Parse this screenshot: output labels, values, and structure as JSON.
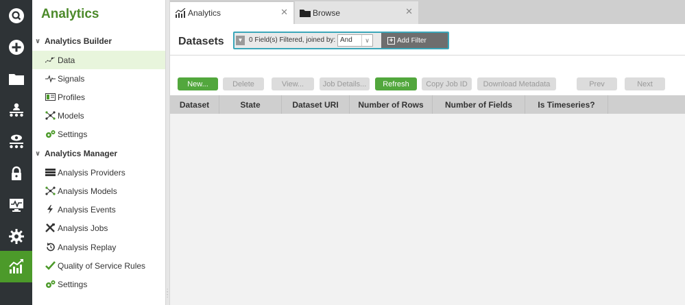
{
  "rail": {
    "items": [
      {
        "icon": "search-icon"
      },
      {
        "icon": "plus-icon"
      },
      {
        "icon": "folder-icon"
      },
      {
        "icon": "org-chart-icon"
      },
      {
        "icon": "eye-hierarchy-icon"
      },
      {
        "icon": "lock-icon"
      },
      {
        "icon": "monitor-icon"
      },
      {
        "icon": "gear-icon"
      },
      {
        "icon": "analytics-chart-icon",
        "active": true
      }
    ],
    "active_color": "#4c9a2a"
  },
  "nav": {
    "title": "Analytics",
    "sections": [
      {
        "label": "Analytics Builder",
        "items": [
          {
            "label": "Data",
            "icon": "data-line-icon",
            "selected": true
          },
          {
            "label": "Signals",
            "icon": "signal-wave-icon"
          },
          {
            "label": "Profiles",
            "icon": "profile-card-icon"
          },
          {
            "label": "Models",
            "icon": "model-nodes-icon"
          },
          {
            "label": "Settings",
            "icon": "settings-gears-icon"
          }
        ]
      },
      {
        "label": "Analytics Manager",
        "items": [
          {
            "label": "Analysis Providers",
            "icon": "server-icon"
          },
          {
            "label": "Analysis Models",
            "icon": "model-nodes-icon"
          },
          {
            "label": "Analysis Events",
            "icon": "lightning-icon"
          },
          {
            "label": "Analysis Jobs",
            "icon": "tools-icon"
          },
          {
            "label": "Analysis Replay",
            "icon": "replay-icon"
          },
          {
            "label": "Quality of Service Rules",
            "icon": "checkmark-icon"
          },
          {
            "label": "Settings",
            "icon": "settings-gears-icon"
          }
        ]
      }
    ]
  },
  "tabs": [
    {
      "label": "Analytics",
      "icon": "analytics-chart-icon",
      "close": "✕",
      "active": true
    },
    {
      "label": "Browse",
      "icon": "folder-icon",
      "close": "✕"
    }
  ],
  "main": {
    "title": "Datasets",
    "filter": {
      "status_text": "0 Field(s) Filtered, joined by:",
      "join_value": "And",
      "add_label": "Add Filter"
    },
    "buttons": [
      {
        "label": "New...",
        "enabled": true
      },
      {
        "label": "Delete",
        "enabled": false
      },
      {
        "label": "View...",
        "enabled": false
      },
      {
        "label": "Job Details...",
        "enabled": false
      },
      {
        "label": "Refresh",
        "enabled": true
      },
      {
        "label": "Copy Job ID",
        "enabled": false
      },
      {
        "label": "Download Metadata",
        "enabled": false
      },
      {
        "label": "Prev",
        "enabled": false
      },
      {
        "label": "Next",
        "enabled": false
      }
    ],
    "columns": [
      "Dataset",
      "State",
      "Dataset URI",
      "Number of Rows",
      "Number of Fields",
      "Is Timeseries?"
    ]
  },
  "colors": {
    "accent_green": "#52a73d",
    "title_green": "#4c8a2a",
    "filter_border": "#3aa6b9",
    "rail_bg": "#2e3336"
  }
}
